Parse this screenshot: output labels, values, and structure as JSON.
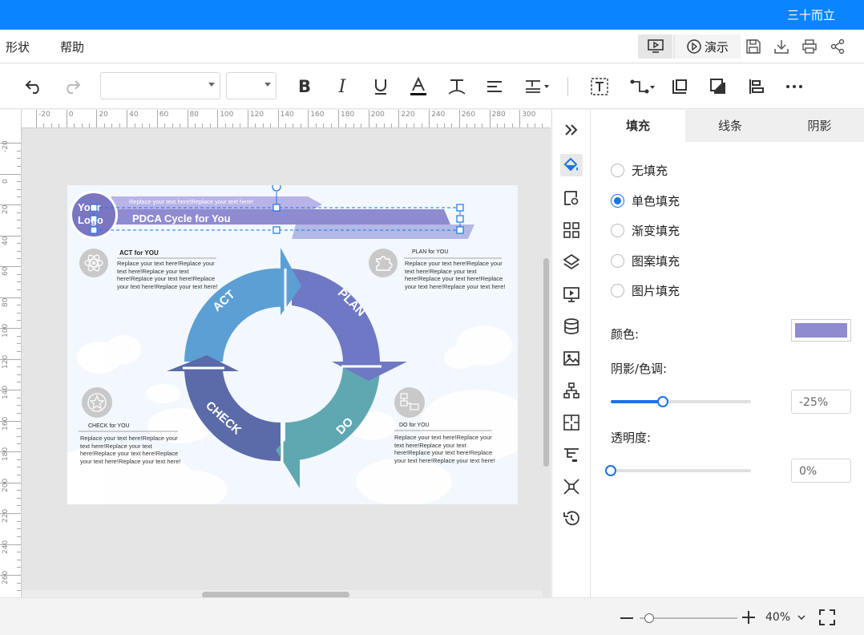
{
  "header": {
    "user_name": "三十而立"
  },
  "menu": {
    "shape": "形状",
    "help": "帮助",
    "present": "演示"
  },
  "toolbar": {
    "font_family": "",
    "font_size": ""
  },
  "ruler": {
    "h_labels": [
      "-20",
      "0",
      "20",
      "40",
      "60",
      "80",
      "100",
      "120",
      "140",
      "160",
      "180",
      "200",
      "220",
      "240",
      "260",
      "280",
      "300"
    ],
    "v_labels": [
      "-20",
      "0",
      "20",
      "40",
      "60",
      "80",
      "100",
      "120",
      "140",
      "160",
      "180",
      "200",
      "220",
      "240",
      "260"
    ]
  },
  "diagram": {
    "logo": "Your Logo",
    "banner_top": "Replace your text here!Replace your text here!",
    "title": "PDCA Cycle for You",
    "act_heading": "ACT for YOU",
    "plan_heading": "PLAN for YOU",
    "check_heading": "CHECK for YOU",
    "do_heading": "DO for YOU",
    "act_body": "Replace your text here!Replace your text here!Replace your text here!Replace your text here!Replace your text here!Replace your text here!",
    "plan_body": "Replace your text here!Replace your text here!Replace your text here!Replace your text here!Replace your text here!Replace your text here!",
    "check_body": "Replace your text here!Replace your text here!Replace your text here!Replace your text here!Replace your text here!Replace your text here!",
    "do_body": "Replace your text here!Replace your text here!Replace your text here!Replace your text here!Replace your text here!Replace your text here!",
    "arc_act": "ACT",
    "arc_plan": "PLAN",
    "arc_do": "DO",
    "arc_check": "CHECK"
  },
  "panel": {
    "tabs": [
      "填充",
      "线条",
      "阴影"
    ],
    "fill_options": [
      "无填充",
      "单色填充",
      "渐变填充",
      "图案填充",
      "图片填充"
    ],
    "selected_fill": "单色填充",
    "color_label": "颜色:",
    "color_value": "#8e8bd0",
    "shade_label": "阴影/色调:",
    "shade_value": "-25%",
    "shade_level": 0.37,
    "opacity_label": "透明度:",
    "opacity_value": "0%",
    "opacity_level": 0
  },
  "status": {
    "zoom": "40%"
  },
  "colors": {
    "accent": "#0a84ff",
    "act_arc": "#5b9fd4",
    "plan_arc": "#6f78c4",
    "do_arc": "#5fa8b2",
    "check_arc": "#5b6aa8"
  }
}
